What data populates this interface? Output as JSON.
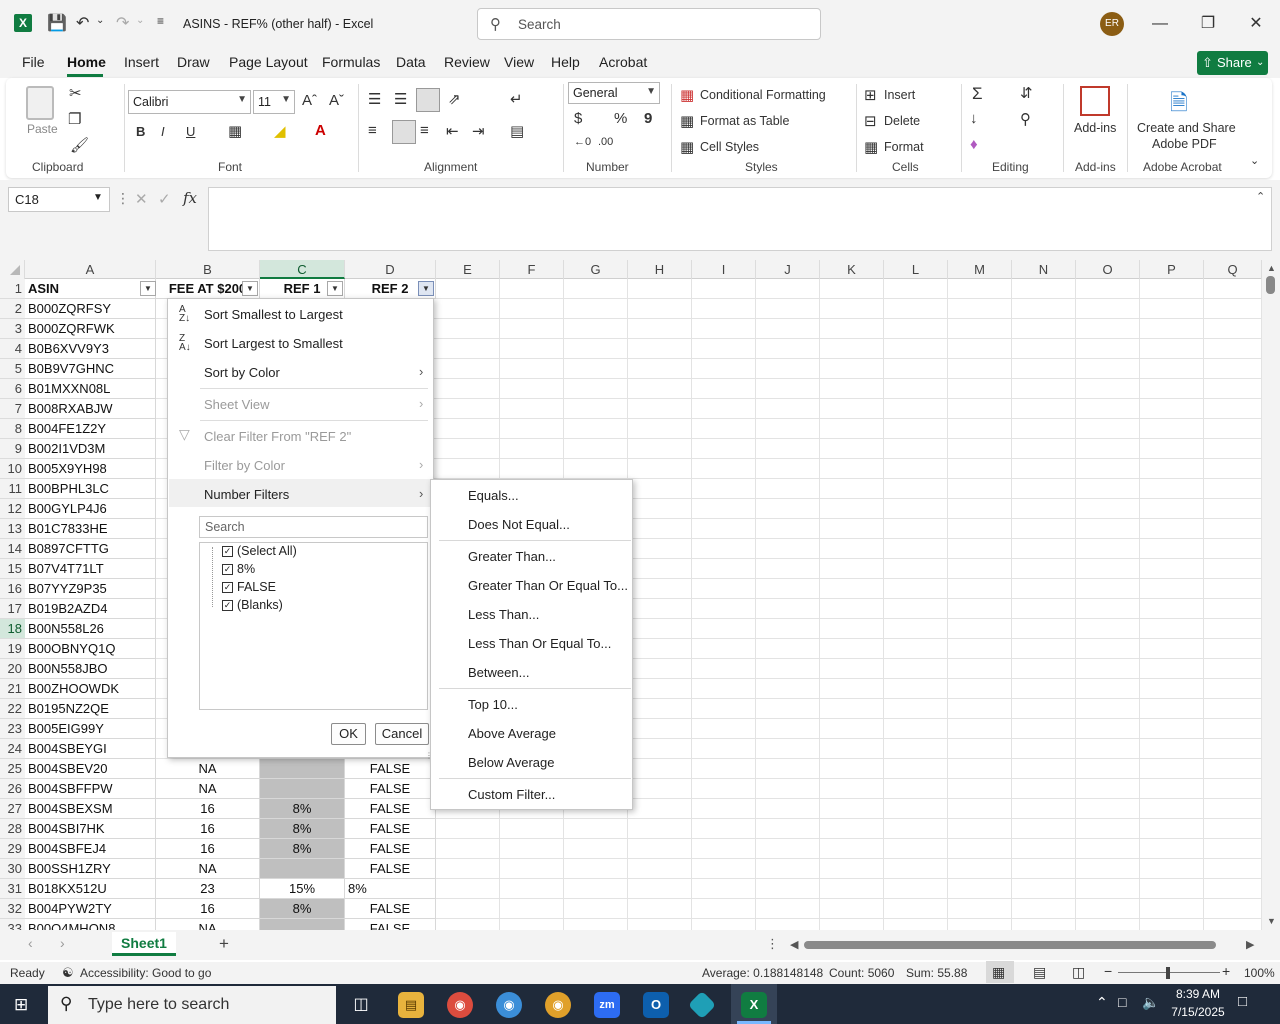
{
  "titlebar": {
    "doc_title": "ASINS - REF% (other half)  -  Excel",
    "search_placeholder": "Search",
    "avatar_initials": "ER"
  },
  "menu": {
    "tabs": [
      "File",
      "Home",
      "Insert",
      "Draw",
      "Page Layout",
      "Formulas",
      "Data",
      "Review",
      "View",
      "Help",
      "Acrobat"
    ],
    "active": "Home",
    "share_label": "Share"
  },
  "ribbon": {
    "clipboard": {
      "paste_label": "Paste",
      "group": "Clipboard"
    },
    "font": {
      "family": "Calibri",
      "size": "11",
      "group": "Font",
      "bold": "B",
      "italic": "I",
      "underline": "U"
    },
    "alignment": {
      "group": "Alignment"
    },
    "number": {
      "format": "General",
      "group": "Number",
      "dollar": "$",
      "percent": "%",
      "comma": "9"
    },
    "styles": {
      "conditional": "Conditional Formatting",
      "format_table": "Format as Table",
      "cell_styles": "Cell Styles",
      "group": "Styles"
    },
    "cells": {
      "insert": "Insert",
      "delete": "Delete",
      "format": "Format",
      "group": "Cells"
    },
    "editing": {
      "group": "Editing"
    },
    "addins": {
      "label": "Add-ins",
      "group": "Add-ins"
    },
    "acrobat": {
      "label1": "Create and Share",
      "label2": "Adobe PDF",
      "group": "Adobe Acrobat"
    }
  },
  "formula": {
    "namebox": "C18",
    "fx": "fx",
    "content": ""
  },
  "columns": [
    "A",
    "B",
    "C",
    "D",
    "E",
    "F",
    "G",
    "H",
    "I",
    "J",
    "K",
    "L",
    "M",
    "N",
    "O",
    "P",
    "Q"
  ],
  "headers": {
    "A": "ASIN",
    "B": "FEE AT $200",
    "C": "REF 1",
    "D": "REF 2"
  },
  "rows": [
    {
      "n": "1"
    },
    {
      "n": "2",
      "a": "B000ZQRFSY"
    },
    {
      "n": "3",
      "a": "B000ZQRFWK"
    },
    {
      "n": "4",
      "a": "B0B6XVV9Y3"
    },
    {
      "n": "5",
      "a": "B0B9V7GHNC"
    },
    {
      "n": "6",
      "a": "B01MXXN08L"
    },
    {
      "n": "7",
      "a": "B008RXABJW"
    },
    {
      "n": "8",
      "a": "B004FE1Z2Y"
    },
    {
      "n": "9",
      "a": "B002I1VD3M"
    },
    {
      "n": "10",
      "a": "B005X9YH98"
    },
    {
      "n": "11",
      "a": "B00BPHL3LC"
    },
    {
      "n": "12",
      "a": "B00GYLP4J6"
    },
    {
      "n": "13",
      "a": "B01C7833HE"
    },
    {
      "n": "14",
      "a": "B0897CFTTG"
    },
    {
      "n": "15",
      "a": "B07V4T71LT"
    },
    {
      "n": "16",
      "a": "B07YYZ9P35"
    },
    {
      "n": "17",
      "a": "B019B2AZD4"
    },
    {
      "n": "18",
      "a": "B00N558L26"
    },
    {
      "n": "19",
      "a": "B00OBNYQ1Q"
    },
    {
      "n": "20",
      "a": "B00N558JBO"
    },
    {
      "n": "21",
      "a": "B00ZHOOWDK"
    },
    {
      "n": "22",
      "a": "B0195NZ2QE"
    },
    {
      "n": "23",
      "a": "B005EIG99Y"
    },
    {
      "n": "24",
      "a": "B004SBEYGI"
    },
    {
      "n": "25",
      "a": "B004SBEV20",
      "b": "NA",
      "c": "",
      "d": "FALSE"
    },
    {
      "n": "26",
      "a": "B004SBFFPW",
      "b": "NA",
      "c": "",
      "d": "FALSE"
    },
    {
      "n": "27",
      "a": "B004SBEXSM",
      "b": "16",
      "c": "8%",
      "d": "FALSE"
    },
    {
      "n": "28",
      "a": "B004SBI7HK",
      "b": "16",
      "c": "8%",
      "d": "FALSE"
    },
    {
      "n": "29",
      "a": "B004SBFEJ4",
      "b": "16",
      "c": "8%",
      "d": "FALSE"
    },
    {
      "n": "30",
      "a": "B00SSH1ZRY",
      "b": "NA",
      "c": "",
      "d": "FALSE"
    },
    {
      "n": "31",
      "a": "B018KX512U",
      "b": "23",
      "c": "15%",
      "d": "8%"
    },
    {
      "n": "32",
      "a": "B004PYW2TY",
      "b": "16",
      "c": "8%",
      "d": "FALSE"
    },
    {
      "n": "33",
      "a": "B00O4MHON8",
      "b": "NA",
      "c": "",
      "d": "FALSE"
    }
  ],
  "filter_menu": {
    "sort_asc": "Sort Smallest to Largest",
    "sort_desc": "Sort Largest to Smallest",
    "sort_color": "Sort by Color",
    "sheet_view": "Sheet View",
    "clear_filter": "Clear Filter From \"REF 2\"",
    "filter_color": "Filter by Color",
    "number_filters": "Number Filters",
    "search_placeholder": "Search",
    "items": [
      "(Select All)",
      "8%",
      "FALSE",
      "(Blanks)"
    ],
    "ok": "OK",
    "cancel": "Cancel"
  },
  "number_filters_submenu": [
    "Equals...",
    "Does Not Equal...",
    "Greater Than...",
    "Greater Than Or Equal To...",
    "Less Than...",
    "Less Than Or Equal To...",
    "Between...",
    "Top 10...",
    "Above Average",
    "Below Average",
    "Custom Filter..."
  ],
  "sheet": {
    "tab": "Sheet1"
  },
  "status": {
    "ready": "Ready",
    "accessibility": "Accessibility: Good to go",
    "average": "Average: 0.188148148",
    "count": "Count: 5060",
    "sum": "Sum: 55.88",
    "zoom": "100%"
  },
  "taskbar": {
    "search": "Type here to search",
    "time": "8:39 AM",
    "date": "7/15/2025"
  },
  "colors": {
    "excel_green": "#107c41",
    "selected_header": "#d3e7dc",
    "grey_cells": "#bfbfbf"
  }
}
